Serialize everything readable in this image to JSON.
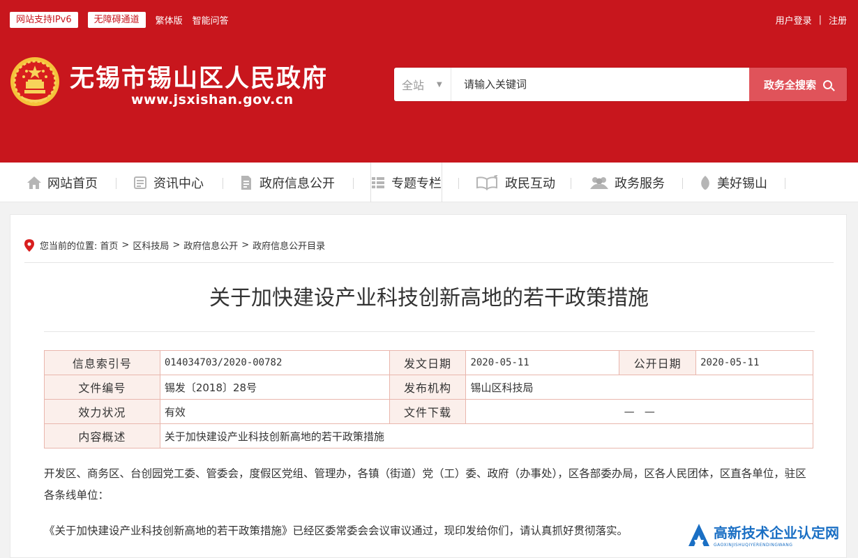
{
  "topbar": {
    "ipv6_label": "网站支持IPv6",
    "accessible_label": "无障碍通道",
    "traditional_label": "繁体版",
    "qa_label": "智能问答",
    "login_label": "用户登录",
    "separator": "|",
    "register_label": "注册"
  },
  "header": {
    "site_name": "无锡市锡山区人民政府",
    "site_url": "www.jsxishan.gov.cn"
  },
  "search": {
    "scope": "全站",
    "placeholder": "请输入关键词",
    "button_label": "政务全搜索"
  },
  "nav": {
    "items": [
      {
        "label": "网站首页",
        "icon": "home-icon"
      },
      {
        "label": "资讯中心",
        "icon": "news-icon"
      },
      {
        "label": "政府信息公开",
        "icon": "document-icon"
      },
      {
        "label": "专题专栏",
        "icon": "list-icon"
      },
      {
        "label": "政民互动",
        "icon": "interaction-icon"
      },
      {
        "label": "政务服务",
        "icon": "people-icon"
      },
      {
        "label": "美好锡山",
        "icon": "leaf-icon"
      }
    ]
  },
  "breadcrumb": {
    "prefix": "您当前的位置:",
    "items": [
      "首页",
      "区科技局",
      "政府信息公开",
      "政府信息公开目录"
    ],
    "arrow": ">"
  },
  "document": {
    "title": "关于加快建设产业科技创新高地的若干政策措施",
    "meta": {
      "index_label": "信息索引号",
      "index_value": "014034703/2020-00782",
      "issue_date_label": "发文日期",
      "issue_date_value": "2020-05-11",
      "public_date_label": "公开日期",
      "public_date_value": "2020-05-11",
      "doc_no_label": "文件编号",
      "doc_no_value": "锡发〔2018〕28号",
      "publisher_label": "发布机构",
      "publisher_value": "锡山区科技局",
      "status_label": "效力状况",
      "status_value": "有效",
      "download_label": "文件下载",
      "download_value": "—   —",
      "summary_label": "内容概述",
      "summary_value": "关于加快建设产业科技创新高地的若干政策措施"
    },
    "paragraphs": [
      "开发区、商务区、台创园党工委、管委会，度假区党组、管理办，各镇（街道）党（工）委、政府（办事处），区各部委办局，区各人民团体，区直各单位，驻区各条线单位：",
      "《关于加快建设产业科技创新高地的若干政策措施》已经区委常委会会议审议通过，现印发给你们，请认真抓好贯彻落实。"
    ]
  },
  "watermark": {
    "cn": "高新技术企业认定网",
    "en": "GAOXINJISHUQIYERENDINGWANG"
  },
  "colors": {
    "brand_red": "#c8161d",
    "table_border": "#e9b6ad",
    "table_label_bg": "#fbefeb",
    "watermark_blue": "#1a6fc4"
  }
}
